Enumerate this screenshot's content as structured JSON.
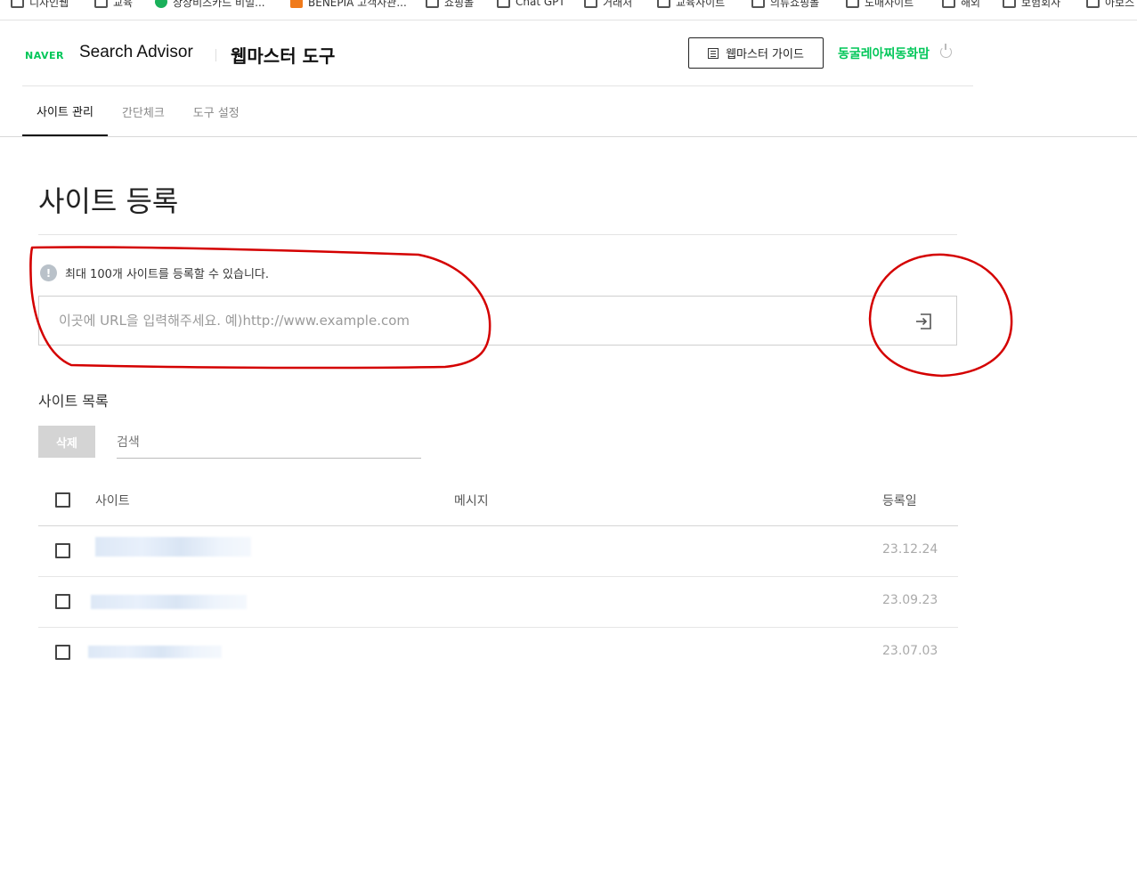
{
  "bookmarks": [
    {
      "label": "디자인웹",
      "icon": "folder-icon"
    },
    {
      "label": "교육",
      "icon": "folder-icon"
    },
    {
      "label": "상상비즈카드 비빌...",
      "icon": "leaf-favicon-icon"
    },
    {
      "label": "BENEPIA 고객사관...",
      "icon": "benepia-favicon-icon"
    },
    {
      "label": "쇼핑몰",
      "icon": "folder-icon"
    },
    {
      "label": "Chat GPT",
      "icon": "folder-icon"
    },
    {
      "label": "거래처",
      "icon": "folder-icon"
    },
    {
      "label": "교육사이트",
      "icon": "folder-icon"
    },
    {
      "label": "의류쇼핑몰",
      "icon": "folder-icon"
    },
    {
      "label": "도매사이트",
      "icon": "folder-icon"
    },
    {
      "label": "해외",
      "icon": "folder-icon"
    },
    {
      "label": "보험회사",
      "icon": "folder-icon"
    },
    {
      "label": "아보스",
      "icon": "folder-icon"
    }
  ],
  "header": {
    "logo": "NAVER",
    "brand": "Search Advisor",
    "subtitle": "웹마스터 도구",
    "guide_button": "웹마스터 가이드",
    "user_name": "동굴레아찌동화맘"
  },
  "tabs": [
    {
      "label": "사이트 관리",
      "active": true
    },
    {
      "label": "간단체크",
      "active": false
    },
    {
      "label": "도구 설정",
      "active": false
    }
  ],
  "register": {
    "title": "사이트 등록",
    "notice": "최대 100개 사이트를 등록할 수 있습니다.",
    "url_placeholder": "이곳에 URL을 입력해주세요. 예)http://www.example.com",
    "url_value": ""
  },
  "site_list": {
    "title": "사이트 목록",
    "delete_button": "삭제",
    "search_placeholder": "검색",
    "columns": {
      "site": "사이트",
      "message": "메시지",
      "registered": "등록일"
    },
    "rows": [
      {
        "site": "",
        "message": "",
        "registered": "23.12.24"
      },
      {
        "site": "",
        "message": "",
        "registered": "23.09.23"
      },
      {
        "site": "",
        "message": "",
        "registered": "23.07.03"
      }
    ]
  },
  "colors": {
    "brand_green": "#03c75a",
    "annotation_red": "#d40000",
    "info_icon": "#b9c1c9",
    "date_text": "#aaaaaa"
  }
}
